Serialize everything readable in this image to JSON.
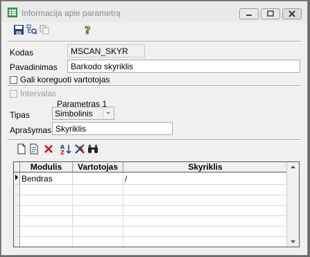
{
  "window": {
    "title": "Informacija apie parametrą"
  },
  "form": {
    "kodas_label": "Kodas",
    "kodas_value": "MSCAN_SKYR",
    "pavadinimas_label": "Pavadinimas",
    "pavadinimas_value": "Barkodo skyriklis",
    "gali_koreguoti_label": "Gali koreguoti vartotojas",
    "intervalas_label": "Intervalas",
    "param_heading": "Parametras 1",
    "tipas_label": "Tipas",
    "tipas_value": "Simbolinis",
    "aprasymas_label": "Aprašymas",
    "aprasymas_value": "Skyriklis"
  },
  "grid": {
    "columns": [
      "Modulis",
      "Vartotojas",
      "Skyriklis"
    ],
    "rows": [
      [
        "Bendras",
        "",
        "/"
      ]
    ]
  },
  "colors": {
    "accent_green": "#2e8b3a",
    "save_blue": "#1c3f8c",
    "delete_red": "#cc1111"
  }
}
